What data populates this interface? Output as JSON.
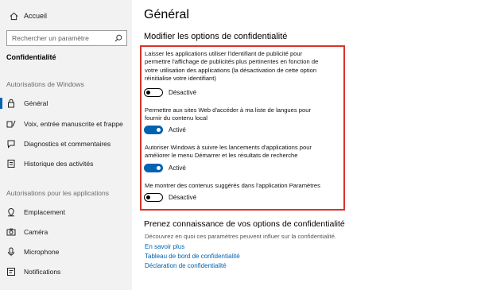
{
  "sidebar": {
    "home_label": "Accueil",
    "search_placeholder": "Rechercher un paramètre",
    "section_title": "Confidentialité",
    "group1_title": "Autorisations de Windows",
    "group1_items": [
      {
        "label": "Général",
        "icon": "lock-icon"
      },
      {
        "label": "Voix, entrée manuscrite et frappe",
        "icon": "microphone-pen-icon"
      },
      {
        "label": "Diagnostics et commentaires",
        "icon": "feedback-icon"
      },
      {
        "label": "Historique des activités",
        "icon": "history-icon"
      }
    ],
    "group2_title": "Autorisations pour les applications",
    "group2_items": [
      {
        "label": "Emplacement",
        "icon": "location-icon"
      },
      {
        "label": "Caméra",
        "icon": "camera-icon"
      },
      {
        "label": "Microphone",
        "icon": "microphone-icon"
      },
      {
        "label": "Notifications",
        "icon": "notifications-icon"
      }
    ],
    "active_item": "Général",
    "accent_color": "#0063b1"
  },
  "main": {
    "title": "Général",
    "subtitle": "Modifier les options de confidentialité",
    "options": [
      {
        "text_lines": [
          "Laisser les applications utiliser l'identifiant de publicité pour",
          "permettre l'affichage de publicités plus pertinentes en fonction de",
          "votre utilisation des applications (la désactivation de cette option",
          "réinitialise votre identifiant)"
        ],
        "state": "off",
        "state_label": "Désactivé"
      },
      {
        "text_lines": [
          "Permettre aux sites Web d'accéder à ma liste de langues pour",
          "fournir du contenu local"
        ],
        "state": "on",
        "state_label": "Activé"
      },
      {
        "text_lines": [
          "Autoriser Windows à suivre les lancements d'applications pour",
          "améliorer le menu Démarrer et les résultats de recherche"
        ],
        "state": "on",
        "state_label": "Activé"
      },
      {
        "text_lines": [
          "Me montrer des contenus suggérés dans l'application Paramètres"
        ],
        "state": "off",
        "state_label": "Désactivé"
      }
    ],
    "highlight_color": "#d9342b",
    "know_title": "Prenez connaissance de vos options de confidentialité",
    "know_desc": "Découvrez en quoi ces paramètres peuvent influer sur la confidentialité.",
    "links": [
      "En savoir plus",
      "Tableau de bord de confidentialité",
      "Déclaration de confidentialité"
    ]
  }
}
